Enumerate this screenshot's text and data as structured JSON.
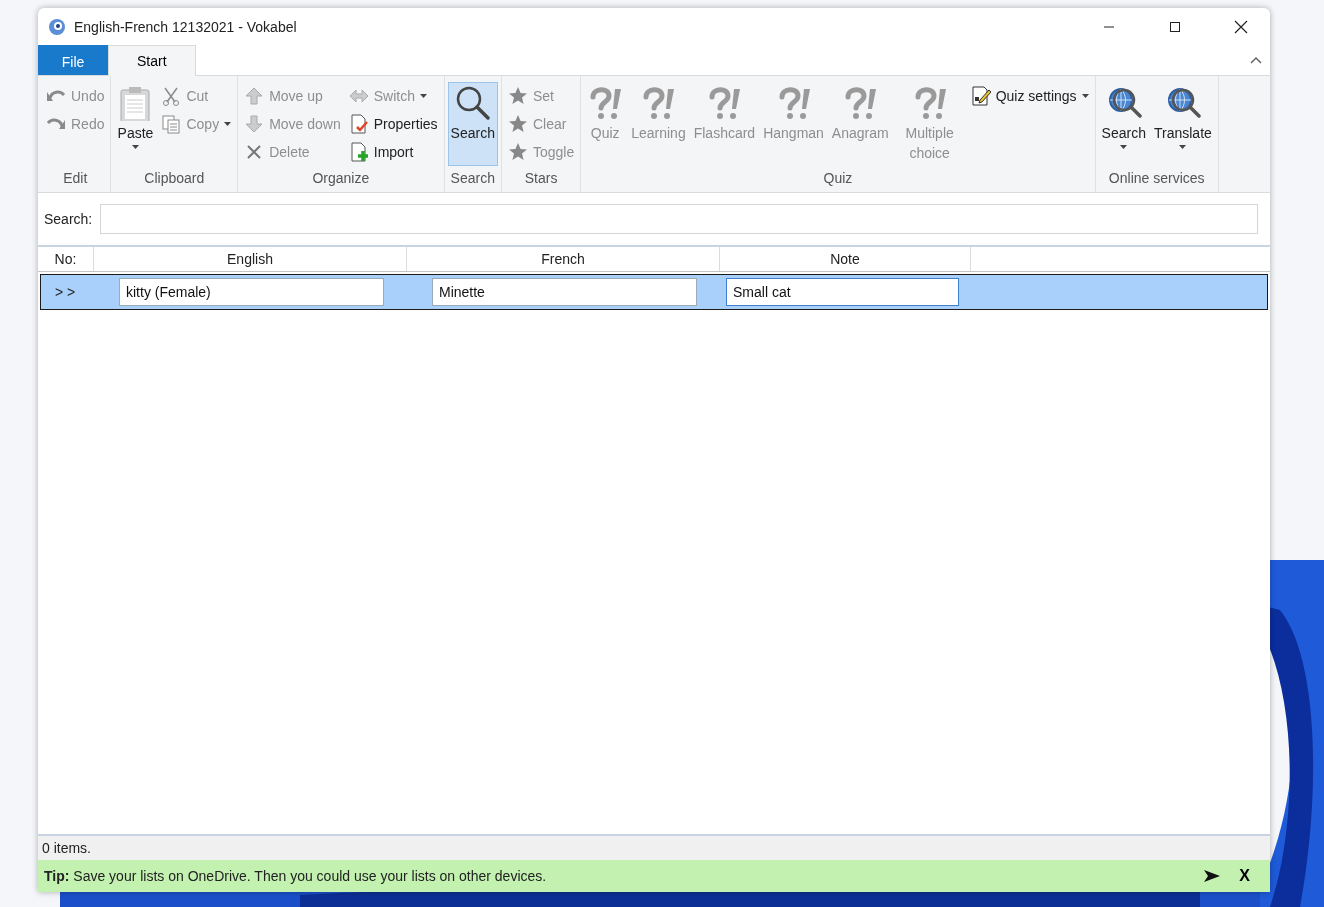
{
  "window": {
    "title": "English-French 12132021 - Vokabel"
  },
  "tabs": [
    {
      "label": "File",
      "kind": "file",
      "selected": false
    },
    {
      "label": "Start",
      "kind": "tab",
      "selected": true
    }
  ],
  "ribbon": {
    "groups": [
      {
        "label": "Edit",
        "items": [
          {
            "label": "Undo",
            "kind": "small",
            "disabled": true,
            "dropdown": false
          },
          {
            "label": "Redo",
            "kind": "small",
            "disabled": true,
            "dropdown": false
          }
        ]
      },
      {
        "label": "Clipboard",
        "items": [
          {
            "label": "Paste",
            "kind": "large",
            "disabled": false,
            "dropdown": true
          },
          {
            "label": "Cut",
            "kind": "small",
            "disabled": true,
            "dropdown": false
          },
          {
            "label": "Copy",
            "kind": "small",
            "disabled": true,
            "dropdown": true
          }
        ]
      },
      {
        "label": "Organize",
        "items": [
          {
            "label": "Move up",
            "kind": "small",
            "disabled": true,
            "dropdown": false
          },
          {
            "label": "Move down",
            "kind": "small",
            "disabled": true,
            "dropdown": false
          },
          {
            "label": "Delete",
            "kind": "small",
            "disabled": true,
            "dropdown": false
          },
          {
            "label": "Switch",
            "kind": "small",
            "disabled": true,
            "dropdown": true
          },
          {
            "label": "Properties",
            "kind": "small",
            "disabled": false,
            "dropdown": false
          },
          {
            "label": "Import",
            "kind": "small",
            "disabled": false,
            "dropdown": false
          }
        ]
      },
      {
        "label": "Search",
        "items": [
          {
            "label": "Search",
            "kind": "large",
            "disabled": false,
            "dropdown": false,
            "active": true
          }
        ]
      },
      {
        "label": "Stars",
        "items": [
          {
            "label": "Set",
            "kind": "small",
            "disabled": true,
            "dropdown": false
          },
          {
            "label": "Clear",
            "kind": "small",
            "disabled": true,
            "dropdown": false
          },
          {
            "label": "Toggle",
            "kind": "small",
            "disabled": true,
            "dropdown": false
          }
        ]
      },
      {
        "label": "Quiz",
        "items": [
          {
            "label": "Quiz",
            "kind": "large",
            "disabled": true,
            "dropdown": false
          },
          {
            "label": "Learning",
            "kind": "large",
            "disabled": true,
            "dropdown": false
          },
          {
            "label": "Flashcard",
            "kind": "large",
            "disabled": true,
            "dropdown": false
          },
          {
            "label": "Hangman",
            "kind": "large",
            "disabled": true,
            "dropdown": false
          },
          {
            "label": "Anagram",
            "kind": "large",
            "disabled": true,
            "dropdown": false
          },
          {
            "label": "Multiple choice",
            "kind": "large",
            "disabled": true,
            "dropdown": false
          },
          {
            "label": "Quiz settings",
            "kind": "small",
            "disabled": false,
            "dropdown": true
          }
        ]
      },
      {
        "label": "Online services",
        "items": [
          {
            "label": "Search",
            "kind": "large",
            "disabled": false,
            "dropdown": true
          },
          {
            "label": "Translate",
            "kind": "large",
            "disabled": false,
            "dropdown": true
          }
        ]
      }
    ]
  },
  "search": {
    "label": "Search:"
  },
  "table": {
    "columns": [
      "No:",
      "English",
      "French",
      "Note"
    ],
    "rows": [
      {
        "marker": "> >",
        "english": "kitty (Female)",
        "french": "Minette",
        "note": "Small cat",
        "selected": true
      }
    ]
  },
  "status_bar": {
    "text": "0 items."
  },
  "tip": {
    "text": "**Tip:** Save your lists on OneDrive. Then you could use your lists on other devices.",
    "close": "X"
  }
}
